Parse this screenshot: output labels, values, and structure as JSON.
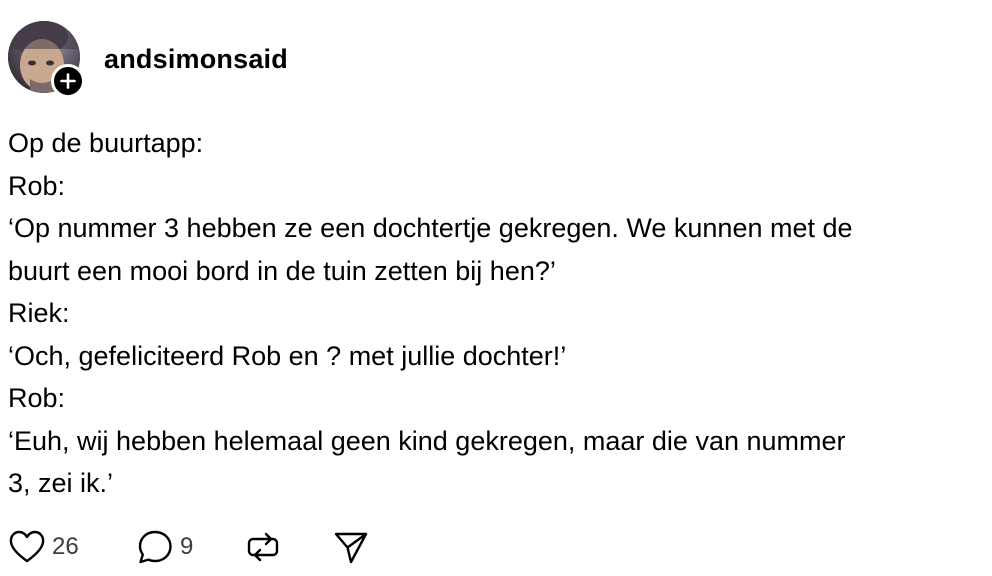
{
  "post": {
    "username": "andsimonsaid",
    "lines": [
      "Op de buurtapp:",
      "Rob:",
      "‘Op nummer 3 hebben ze een dochtertje gekregen. We kunnen met de",
      "buurt een mooi bord in de tuin zetten bij hen?’",
      "Riek:",
      "‘Och, gefeliciteerd Rob en ? met jullie dochter!’",
      "Rob:",
      "‘Euh, wij hebben helemaal geen kind gekregen, maar die van nummer",
      "3, zei ik.’"
    ]
  },
  "actions": {
    "likes_count": "26",
    "replies_count": "9",
    "like_icon": "heart-icon",
    "reply_icon": "speech-bubble-icon",
    "repost_icon": "repost-icon",
    "share_icon": "send-icon",
    "follow_icon": "plus-icon"
  }
}
